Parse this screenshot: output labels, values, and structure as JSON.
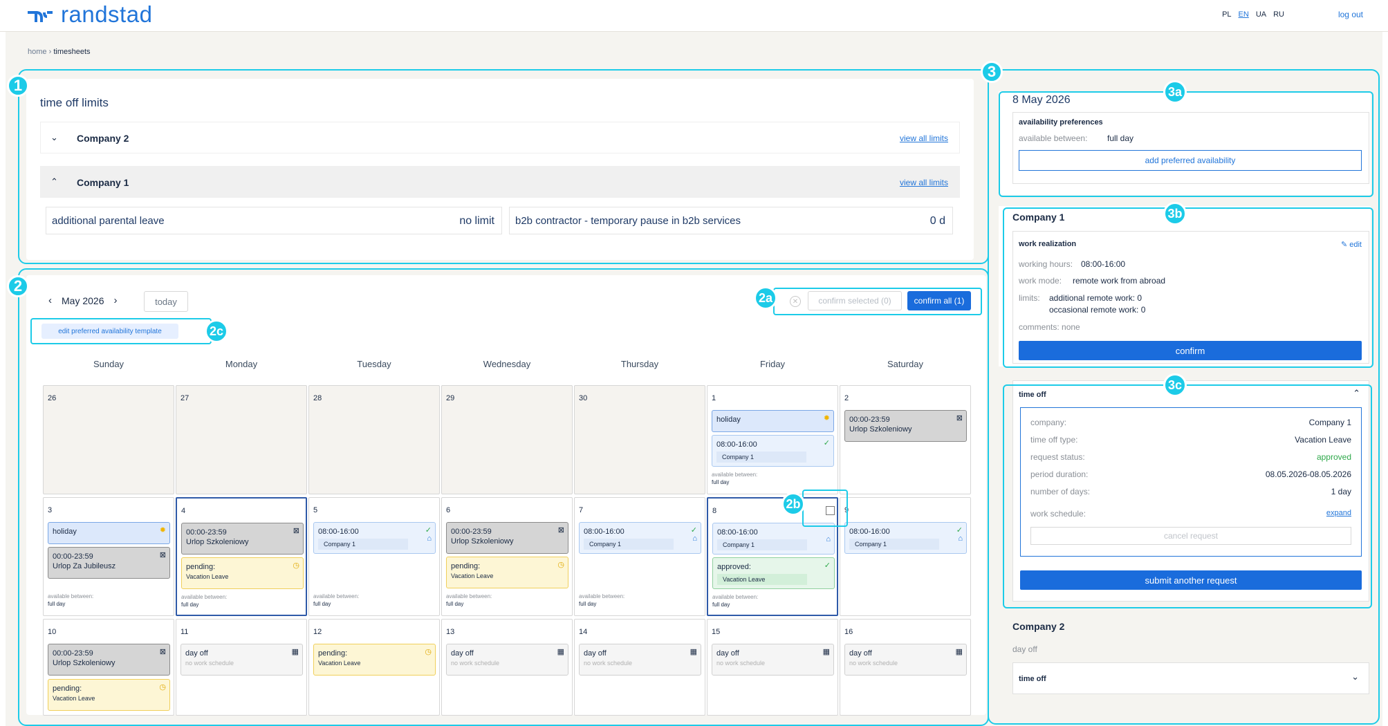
{
  "header": {
    "logo_text": "randstad",
    "languages": [
      "PL",
      "EN",
      "UA",
      "RU"
    ],
    "active_language": "EN",
    "logout": "log out"
  },
  "breadcrumb": {
    "home": "home",
    "separator": "›",
    "current": "timesheets"
  },
  "callouts": {
    "c1": "1",
    "c2": "2",
    "c2a": "2a",
    "c2b": "2b",
    "c2c": "2c",
    "c3": "3",
    "c3a": "3a",
    "c3b": "3b",
    "c3c": "3c"
  },
  "time_off_limits": {
    "title": "time off limits",
    "companies": [
      {
        "name": "Company 2",
        "expanded": false,
        "link": "view all limits",
        "chevron": "⌄"
      },
      {
        "name": "Company 1",
        "expanded": true,
        "link": "view all limits",
        "chevron": "^"
      }
    ],
    "limits": [
      {
        "name": "additional parental leave",
        "value": "no limit"
      },
      {
        "name": "b2b contractor - temporary pause in b2b services",
        "value": "0 d"
      }
    ]
  },
  "calendar": {
    "month": "May 2026",
    "prev": "‹",
    "next": "›",
    "today": "today",
    "template_button": "edit preferred availability template",
    "confirm_selected": "confirm selected (0)",
    "confirm_all": "confirm all (1)",
    "weekdays": [
      "Sunday",
      "Monday",
      "Tuesday",
      "Wednesday",
      "Thursday",
      "Friday",
      "Saturday"
    ],
    "avail_label": "available between:",
    "avail_value": "full day",
    "days": {
      "d26": "26",
      "d27": "27",
      "d28": "28",
      "d29": "29",
      "d30": "30",
      "d1": "1",
      "d2": "2",
      "d3": "3",
      "d4": "4",
      "d5": "5",
      "d6": "6",
      "d7": "7",
      "d8": "8",
      "d9": "9",
      "d10": "10",
      "d11": "11",
      "d12": "12",
      "d13": "13",
      "d14": "14",
      "d15": "15",
      "d16": "16"
    },
    "events": {
      "holiday": "holiday",
      "shift": "08:00-16:00",
      "company1": "Company 1",
      "allday": "00:00-23:59",
      "urlop_szk": "Urlop Szkoleniowy",
      "urlop_jub": "Urlop Za Jubileusz",
      "pending": "pending:",
      "approved": "approved:",
      "vacation": "Vacation Leave",
      "day_off": "day off",
      "no_schedule": "no work schedule"
    }
  },
  "right": {
    "date": "8 May 2026",
    "availability": {
      "title": "availability preferences",
      "label": "available between:",
      "value": "full day",
      "button": "add preferred availability"
    },
    "company1": {
      "name": "Company 1",
      "work_title": "work realization",
      "edit": "edit",
      "hours_label": "working hours:",
      "hours_value": "08:00-16:00",
      "mode_label": "work mode:",
      "mode_value": "remote work from abroad",
      "limits_label": "limits:",
      "limit1": "additional remote work: 0",
      "limit2": "occasional remote work: 0",
      "comments": "comments: none",
      "confirm": "confirm"
    },
    "time_off": {
      "title": "time off",
      "rows": [
        {
          "label": "company:",
          "value": "Company 1"
        },
        {
          "label": "time off type:",
          "value": "Vacation Leave"
        },
        {
          "label": "request status:",
          "value": "approved"
        },
        {
          "label": "period duration:",
          "value": "08.05.2026-08.05.2026"
        },
        {
          "label": "number of days:",
          "value": "1 day"
        }
      ],
      "schedule_label": "work schedule:",
      "expand": "expand",
      "cancel": "cancel request",
      "submit": "submit another request",
      "status_color": "#2ea84a"
    },
    "company2": {
      "name": "Company 2",
      "status": "day off",
      "time_off": "time off"
    }
  },
  "colors": {
    "accent": "#2175d9",
    "callout": "#1ccbe8",
    "primary_button": "#1a6cdc"
  }
}
